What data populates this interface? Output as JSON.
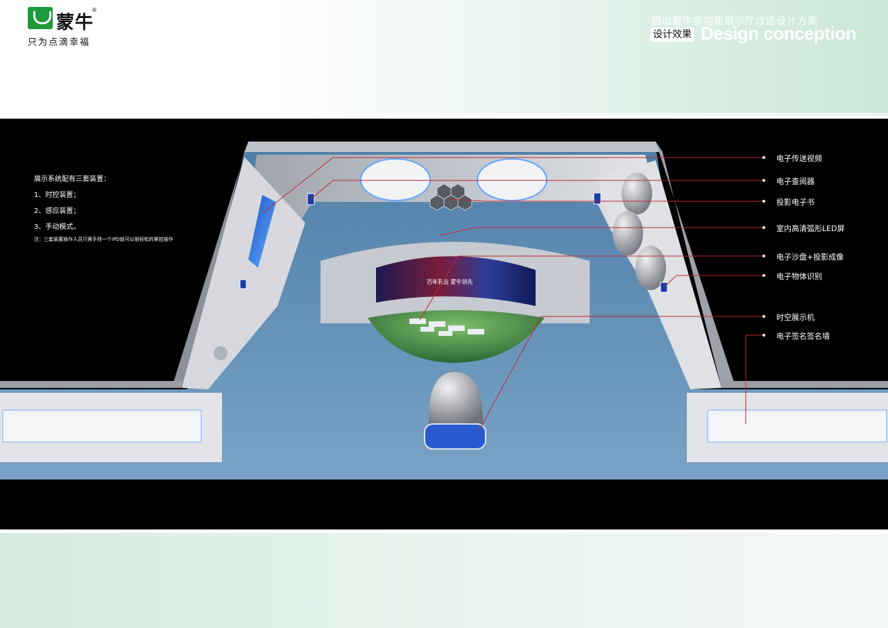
{
  "brand": {
    "logo_name": "蒙牛",
    "registered_mark": "®",
    "slogan": "只为点滴幸福",
    "green": "#1d9a3a"
  },
  "header": {
    "project_title": "眉山蒙牛多功能展示厅改造设计方案",
    "section_cn": "设计效果",
    "section_en": "Design conception"
  },
  "notes": {
    "heading": "展示系统配有三套装置：",
    "items": [
      "1、时控装置；",
      "2、感应装置；",
      "3、手动模式。"
    ],
    "footnote": "注：三套装置操作人员只需手持一个IPD就可以很轻松的掌控操作"
  },
  "callouts": [
    {
      "label": "电子传送视频"
    },
    {
      "label": "电子查阅器"
    },
    {
      "label": "投影电子书"
    },
    {
      "label": "室内高清弧形LED屏"
    },
    {
      "label": "电子沙盘+投影成像"
    },
    {
      "label": "电子物体识别"
    },
    {
      "label": "时空展示机"
    },
    {
      "label": "电子签名签名墙"
    }
  ],
  "screen_text": "百年乳业 蒙牛领先",
  "colors": {
    "callout_line": "#c0272d",
    "floor": "#5f8fb8",
    "wall": "#c9ccd3",
    "header_gradient_end": "#c9e7d6"
  }
}
